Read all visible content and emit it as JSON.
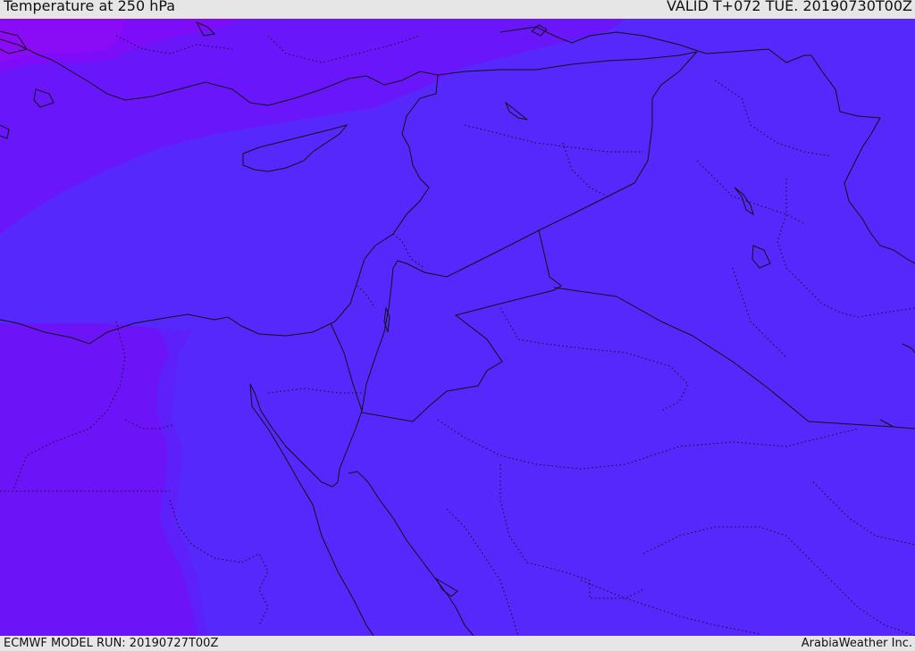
{
  "header": {
    "title": "Temperature at 250 hPa",
    "valid_time": "VALID T+072 TUE. 20190730T00Z"
  },
  "footer": {
    "model_run": "ECMWF MODEL RUN: 20190727T00Z",
    "credit": "ArabiaWeather Inc."
  },
  "map": {
    "colors": {
      "main_field": "#5628fb",
      "cold_band_nw": "#6a16fb",
      "cold_core_nw": "#8a0bf6",
      "west_band": "#6c13f8",
      "transition_band": "#5e20fa",
      "borders": "#111111"
    }
  }
}
